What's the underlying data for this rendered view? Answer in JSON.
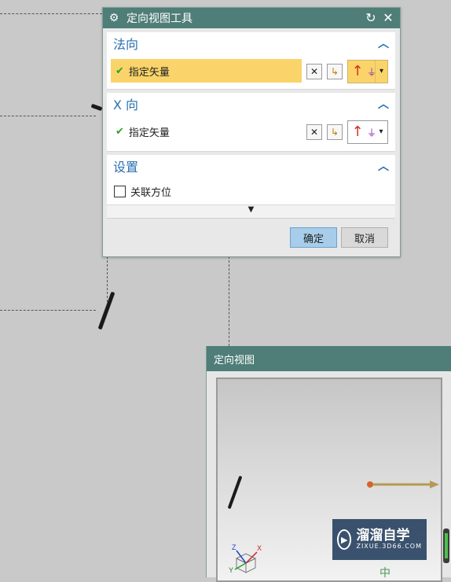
{
  "dialog": {
    "title": "定向视图工具",
    "icons": {
      "settings": "gear-icon",
      "reset": "reset-icon",
      "close": "close-icon"
    },
    "sections": {
      "normal": {
        "title": "法向",
        "row_label": "指定矢量"
      },
      "xdir": {
        "title": "X 向",
        "row_label": "指定矢量"
      },
      "settings": {
        "title": "设置",
        "checkbox_label": "关联方位"
      }
    },
    "ok_label": "确定",
    "cancel_label": "取消"
  },
  "preview": {
    "title": "定向视图",
    "triad": {
      "x": "X",
      "y": "Y",
      "z": "Z"
    }
  },
  "watermark": {
    "main": "溜溜自学",
    "sub": "ZIXUE.3D66.COM",
    "partial_char": "中"
  },
  "colors": {
    "title_bar": "#4f7d78",
    "section_title": "#2b6fb0",
    "highlight_row": "#fad46a",
    "ok_button": "#a7cdea"
  }
}
